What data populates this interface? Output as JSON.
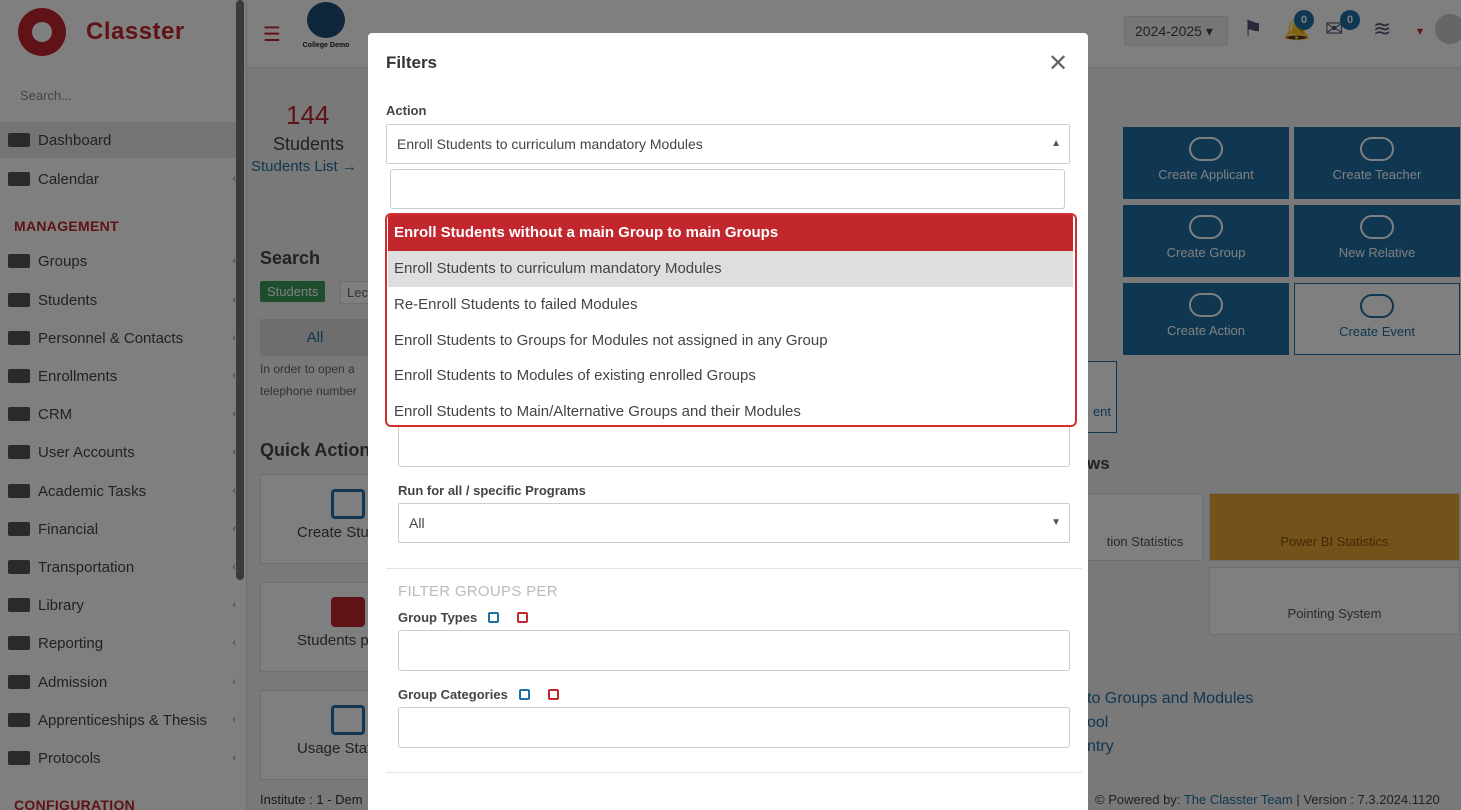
{
  "app": {
    "brand": "Classter",
    "college_name": "College Demo",
    "accent": "#c1272d",
    "blue": "#1f6fa3"
  },
  "sidebar": {
    "search_placeholder": "Search...",
    "items": [
      {
        "label": "Dashboard",
        "icon": "monitor-icon"
      },
      {
        "label": "Calendar",
        "icon": "calendar-icon"
      },
      {
        "label": "Groups",
        "icon": "groups-icon"
      },
      {
        "label": "Students",
        "icon": "students-icon"
      },
      {
        "label": "Personnel & Contacts",
        "icon": "person-icon"
      },
      {
        "label": "Enrollments",
        "icon": "arrows-icon"
      },
      {
        "label": "CRM",
        "icon": "shuffle-icon"
      },
      {
        "label": "User Accounts",
        "icon": "key-icon"
      },
      {
        "label": "Academic Tasks",
        "icon": "grid-icon"
      },
      {
        "label": "Financial",
        "icon": "coins-icon"
      },
      {
        "label": "Transportation",
        "icon": "bus-icon"
      },
      {
        "label": "Library",
        "icon": "books-icon"
      },
      {
        "label": "Reporting",
        "icon": "printer-icon"
      },
      {
        "label": "Admission",
        "icon": "building-icon"
      },
      {
        "label": "Apprenticeships & Thesis",
        "icon": "cube-icon"
      },
      {
        "label": "Protocols",
        "icon": "signpost-icon"
      }
    ],
    "sections": {
      "management": "MANAGEMENT",
      "configuration": "CONFIGURATION"
    }
  },
  "topbar": {
    "year": "2024-2025",
    "notifications": "0",
    "messages": "0"
  },
  "main": {
    "stat_number": "144",
    "stat_label": "Students",
    "stat_link": "Students List →",
    "search_title": "Search",
    "tab_students": "Students",
    "tab_lect": "Lect",
    "all_button": "All",
    "hint1": "In order to open a",
    "hint2": "telephone number",
    "quick_actions": "Quick Actions",
    "qa1": "Create Stu",
    "qa2": "Students pe",
    "qa3": "Usage Stat",
    "tiles": {
      "create_applicant": "Create Applicant",
      "create_teacher": "Create Teacher",
      "create_group": "Create Group",
      "new_relative": "New Relative",
      "create_action": "Create Action",
      "create_event": "Create Event",
      "ent_fragment": "ent"
    },
    "views_title": "ws",
    "stat_statistics": "tion Statistics",
    "power_bi": "Power BI Statistics",
    "pointing_system": "Pointing System",
    "link1": "to Groups and Modules",
    "link2": "ool",
    "link3": "ntry",
    "footer_left": "Institute : 1 - Dem",
    "footer_powered": "Powered by:",
    "footer_team": "The Classter Team",
    "footer_version": "| Version : 7.3.2024.1120"
  },
  "modal": {
    "title": "Filters",
    "action_label": "Action",
    "action_value": "Enroll Students to curriculum mandatory Modules",
    "search_value": "",
    "options": [
      "Enroll Students without a main Group to main Groups",
      "Enroll Students to curriculum mandatory Modules",
      "Re-Enroll Students to failed Modules",
      "Enroll Students to Groups for Modules not assigned in any Group",
      "Enroll Students to Modules of existing enrolled Groups",
      "Enroll Students to Main/Alternative Groups and their Modules"
    ],
    "programs_label": "Run for all / specific Programs",
    "programs_value": "All",
    "filter_groups_per": "FILTER GROUPS PER",
    "group_types": "Group Types",
    "group_categories": "Group Categories"
  }
}
